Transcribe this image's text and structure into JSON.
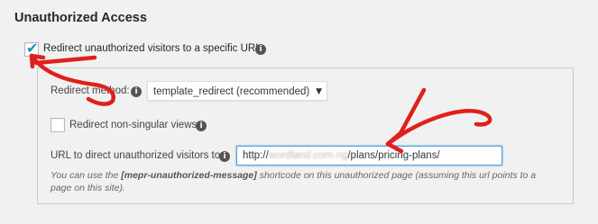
{
  "section": {
    "title": "Unauthorized Access"
  },
  "redirect_checkbox": {
    "label": "Redirect unauthorized visitors to a specific URL",
    "checked": true
  },
  "redirect_method": {
    "label": "Redirect method:",
    "selected": "template_redirect (recommended)"
  },
  "non_singular": {
    "label": "Redirect non-singular views:",
    "checked": false
  },
  "url_field": {
    "label": "URL to direct unauthorized visitors to:",
    "value_prefix": "http://",
    "value_blurred": "wordland.com.ng",
    "value_suffix": "/plans/pricing-plans/"
  },
  "help": {
    "before": "You can use the ",
    "shortcode": "[mepr-unauthorized-message]",
    "after": " shortcode on this unauthorized page (assuming this url points to a page on this site)."
  },
  "icons": {
    "info": "info-icon",
    "check": "check-icon",
    "dropdown": "chevron-down-icon"
  },
  "colors": {
    "annotation_red": "#e0201b",
    "focus_blue": "#5b9dd9",
    "check_blue": "#1e8cbe"
  }
}
